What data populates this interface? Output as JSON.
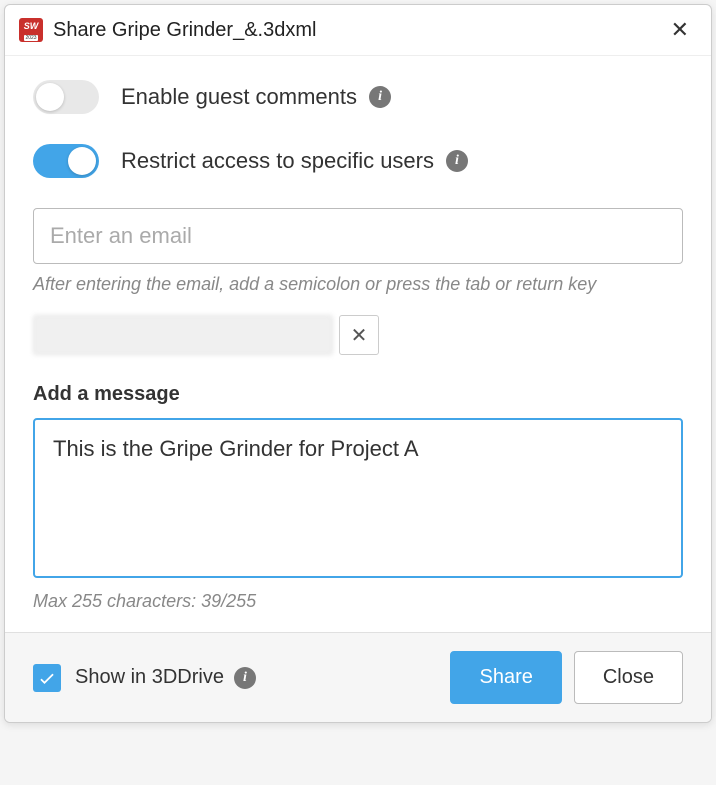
{
  "title": "Share Gripe Grinder_&.3dxml",
  "toggles": {
    "guest_comments": {
      "label": "Enable guest comments",
      "enabled": false
    },
    "restrict_access": {
      "label": "Restrict access to specific users",
      "enabled": true
    }
  },
  "email": {
    "placeholder": "Enter an email",
    "hint": "After entering the email, add a semicolon or press the tab or return key"
  },
  "message": {
    "label": "Add a message",
    "value": "This is the Gripe Grinder for Project A",
    "counter": "Max 255 characters: 39/255"
  },
  "footer": {
    "show_in_drive_label": "Show in 3DDrive",
    "show_in_drive_checked": true,
    "share_label": "Share",
    "close_label": "Close"
  }
}
